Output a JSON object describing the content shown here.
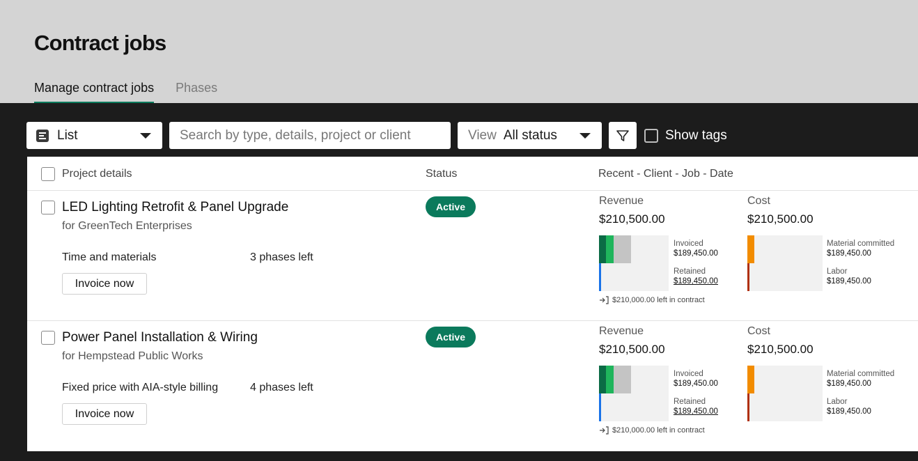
{
  "page": {
    "title": "Contract jobs"
  },
  "tabs": [
    {
      "label": "Manage contract jobs",
      "active": true
    },
    {
      "label": "Phases",
      "active": false
    }
  ],
  "toolbar": {
    "list_label": "List",
    "search_placeholder": "Search by type, details, project or client",
    "view_label": "View",
    "view_value": "All status",
    "show_tags_label": "Show tags"
  },
  "table": {
    "headers": [
      "Project details",
      "Status",
      "Recent - Client - Job - Date"
    ],
    "rows": [
      {
        "title": "LED Lighting Retrofit & Panel Upgrade",
        "client": "for GreenTech Enterprises",
        "type": "Time and materials",
        "phases": "3 phases left",
        "invoice_label": "Invoice now",
        "status": "Active",
        "revenue_label": "Revenue",
        "revenue_value": "$210,500.00",
        "cost_label": "Cost",
        "cost_value": "$210,500.00",
        "invoiced_label": "Invoiced",
        "invoiced_value": "$189,450.00",
        "retained_label": "Retained",
        "retained_value": "$189,450.00",
        "material_label": "Material committed",
        "material_value": "$189,450.00",
        "labor_label": "Labor",
        "labor_value": "$189,450.00",
        "left_in_contract": "$210,000.00 left in contract"
      },
      {
        "title": "Power Panel Installation & Wiring",
        "client": "for Hempstead Public Works",
        "type": "Fixed price with AIA-style billing",
        "phases": "4 phases left",
        "invoice_label": "Invoice now",
        "status": "Active",
        "revenue_label": "Revenue",
        "revenue_value": "$210,500.00",
        "cost_label": "Cost",
        "cost_value": "$210,500.00",
        "invoiced_label": "Invoiced",
        "invoiced_value": "$189,450.00",
        "retained_label": "Retained",
        "retained_value": "$189,450.00",
        "material_label": "Material committed",
        "material_value": "$189,450.00",
        "labor_label": "Labor",
        "labor_value": "$189,450.00",
        "left_in_contract": "$210,000.00 left in contract"
      }
    ]
  },
  "colors": {
    "accent": "#0b7a5c",
    "invoiced_dark": "#0b6b45",
    "invoiced_light": "#1fb55c",
    "pending_gray": "#c4c4c4",
    "retained_blue": "#1a73e8",
    "material_orange": "#f28c00",
    "labor_red": "#b0300e"
  }
}
